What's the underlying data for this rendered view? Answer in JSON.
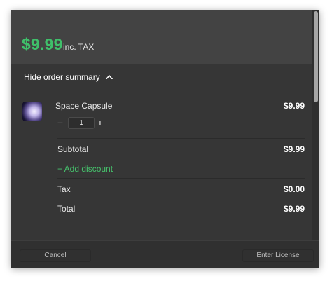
{
  "header": {
    "price": "$9.99",
    "price_suffix": "inc. TAX"
  },
  "summary": {
    "toggle_label": "Hide order summary"
  },
  "product": {
    "name": "Space Capsule",
    "price": "$9.99",
    "quantity": "1",
    "decrement": "−",
    "increment": "+"
  },
  "totals": {
    "subtotal_label": "Subtotal",
    "subtotal_value": "$9.99",
    "add_discount": "+ Add discount",
    "tax_label": "Tax",
    "tax_value": "$0.00",
    "total_label": "Total",
    "total_value": "$9.99"
  },
  "footer": {
    "cancel_label": "Cancel",
    "enter_license_label": "Enter License"
  },
  "colors": {
    "accent_green": "#3fbf6a",
    "background": "#363636",
    "header_background": "#434343"
  }
}
